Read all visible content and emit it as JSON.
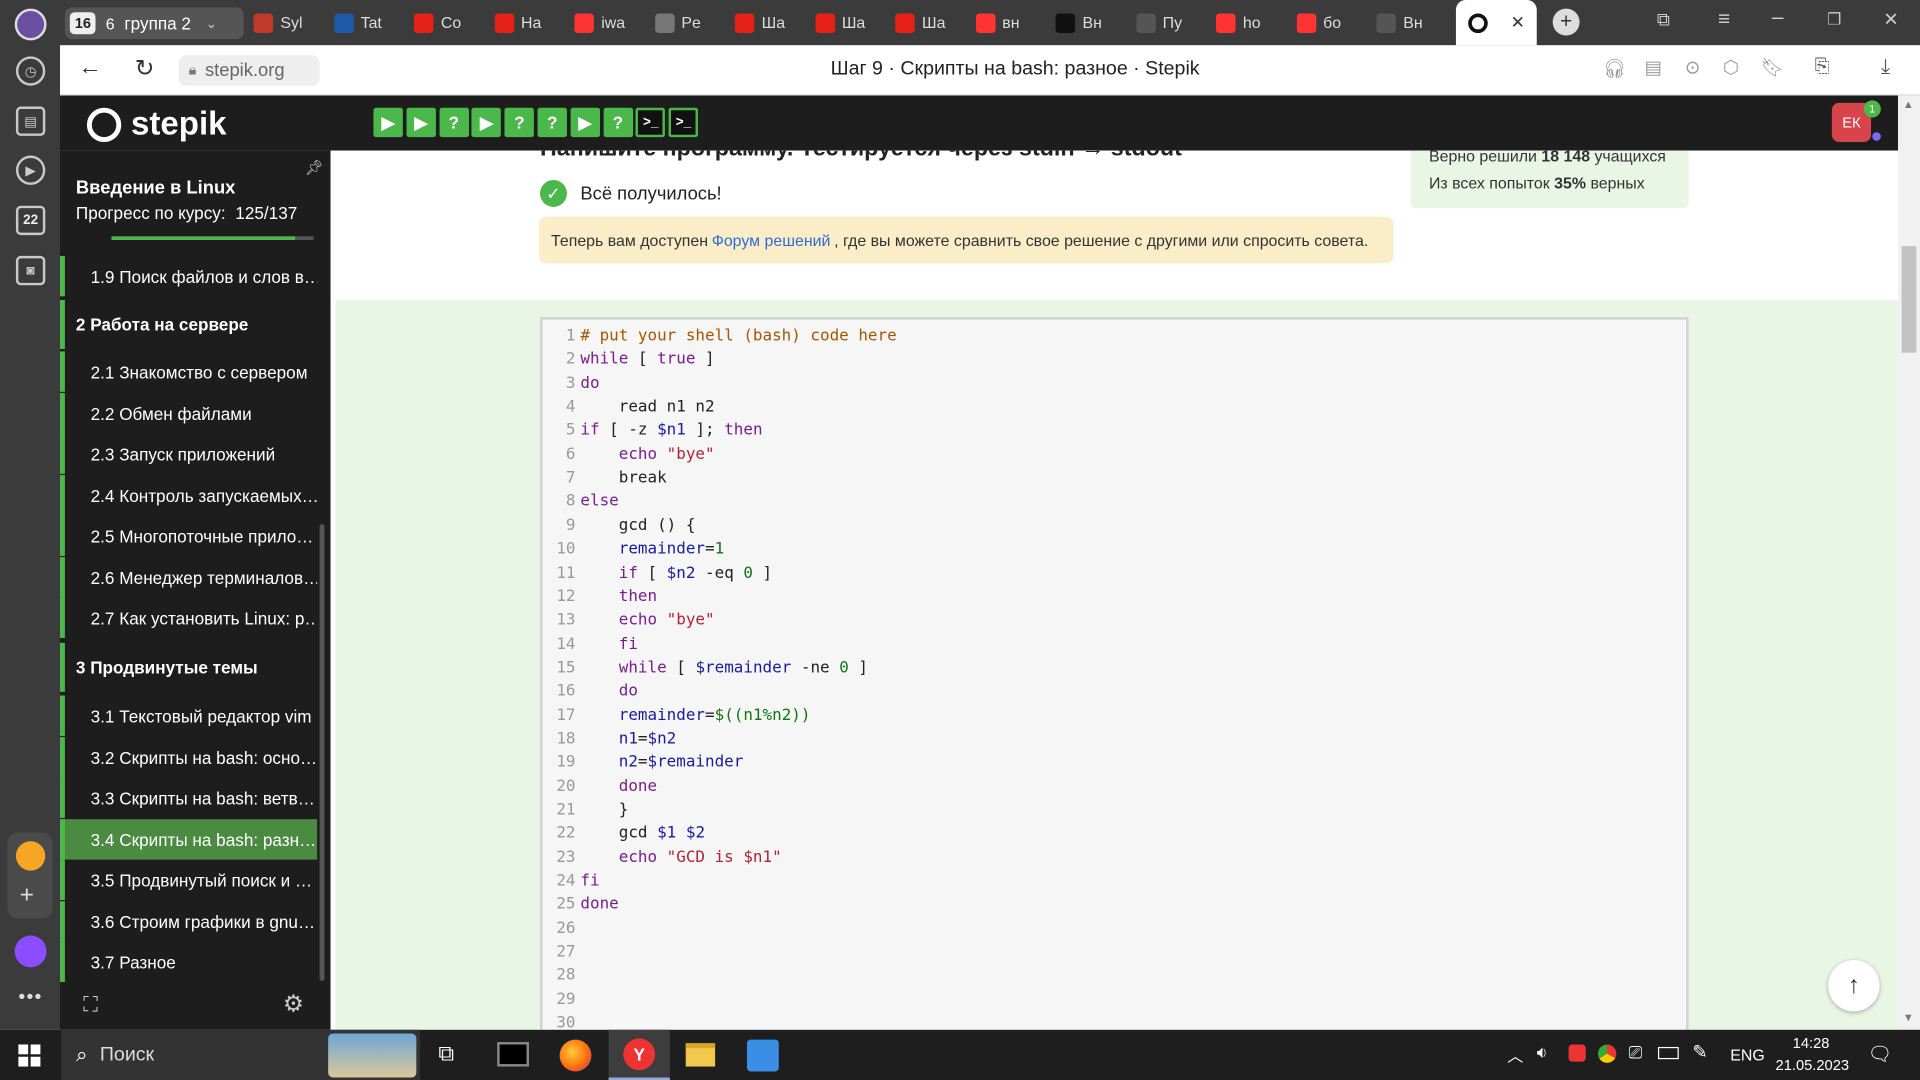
{
  "browser": {
    "tab_count": "16",
    "group_label": "группа 2",
    "tabs": [
      {
        "label": "Syl",
        "icon": "mit-icon",
        "color": "#c0392b"
      },
      {
        "label": "Tat",
        "icon": "blue-circle-icon",
        "color": "#1e5aa8"
      },
      {
        "label": "Co",
        "icon": "youtube-icon",
        "color": "#e62117"
      },
      {
        "label": "Ha",
        "icon": "youtube-icon",
        "color": "#e62117"
      },
      {
        "label": "iwa",
        "icon": "yandex-icon",
        "color": "#f33"
      },
      {
        "label": "Pe",
        "icon": "hat-icon",
        "color": "#777"
      },
      {
        "label": "Ша",
        "icon": "youtube-icon",
        "color": "#e62117"
      },
      {
        "label": "Ша",
        "icon": "youtube-icon",
        "color": "#e62117"
      },
      {
        "label": "Ша",
        "icon": "youtube-icon",
        "color": "#e62117"
      },
      {
        "label": "вн",
        "icon": "yandex-icon",
        "color": "#f33"
      },
      {
        "label": "Вн",
        "icon": "imdb-icon",
        "color": "#111"
      },
      {
        "label": "Пу",
        "icon": "document-icon",
        "color": "#555"
      },
      {
        "label": "ho",
        "icon": "yandex-icon",
        "color": "#f33"
      },
      {
        "label": "бо",
        "icon": "yandex-icon",
        "color": "#f33"
      },
      {
        "label": "Вн",
        "icon": "document-icon",
        "color": "#555"
      }
    ],
    "url": "stepik.org",
    "page_title": "Шаг 9 · Скрипты на bash: разное · Stepik"
  },
  "stepik": {
    "logo": "stepik",
    "avatar": "ЕК",
    "notif_count": "1",
    "step_icons": [
      "play",
      "play",
      "?",
      "play",
      "?",
      "?",
      "play",
      "?",
      "terminal",
      "terminal"
    ]
  },
  "sidebar": {
    "course_title": "Введение в Linux",
    "progress_label": "Прогресс по курсу:",
    "progress_value": "125/137",
    "progress": 0.912,
    "items": [
      {
        "label": "1.9  Поиск файлов и слов в…",
        "type": "lesson"
      },
      {
        "label": "2  Работа на сервере",
        "type": "section"
      },
      {
        "label": "2.1  Знакомство с сервером",
        "type": "lesson"
      },
      {
        "label": "2.2  Обмен файлами",
        "type": "lesson"
      },
      {
        "label": "2.3  Запуск приложений",
        "type": "lesson"
      },
      {
        "label": "2.4  Контроль запускаемых…",
        "type": "lesson"
      },
      {
        "label": "2.5  Многопоточные прило…",
        "type": "lesson"
      },
      {
        "label": "2.6  Менеджер терминалов…",
        "type": "lesson"
      },
      {
        "label": "2.7  Как установить Linux: р…",
        "type": "lesson"
      },
      {
        "label": "3  Продвинутые темы",
        "type": "section"
      },
      {
        "label": "3.1  Текстовый редактор vim",
        "type": "lesson"
      },
      {
        "label": "3.2  Скрипты на bash: осно…",
        "type": "lesson"
      },
      {
        "label": "3.3  Скрипты на bash: ветв…",
        "type": "lesson"
      },
      {
        "label": "3.4  Скрипты на bash: разн…",
        "type": "active"
      },
      {
        "label": "3.5  Продвинутый поиск и …",
        "type": "lesson"
      },
      {
        "label": "3.6  Строим графики в gnu…",
        "type": "lesson"
      },
      {
        "label": "3.7  Разное",
        "type": "lesson"
      }
    ]
  },
  "main": {
    "heading_partial": "Напишите программу. Тестируется через stdin → stdout",
    "success": "Всё получилось!",
    "forum_prefix": "Теперь вам доступен ",
    "forum_link": "Форум решений",
    "forum_suffix": " , где вы можете сравнить свое решение с другими или спросить совета.",
    "stats_line1_prefix": "Верно решили ",
    "stats_line1_value": "18 148",
    "stats_line1_suffix": " учащихся",
    "stats_line2_prefix": "Из всех попыток ",
    "stats_line2_value": "35%",
    "stats_line2_suffix": " верных"
  },
  "code": [
    "# put your shell (bash) code here",
    "while [ true ]",
    "do",
    "    read n1 n2",
    "if [ -z $n1 ]; then",
    "    echo \"bye\"",
    "    break",
    "else",
    "    gcd () {",
    "    remainder=1",
    "    if [ $n2 -eq 0 ]",
    "    then",
    "    echo \"bye\"",
    "    fi",
    "    while [ $remainder -ne 0 ]",
    "    do",
    "    remainder=$((n1%n2))",
    "    n1=$n2",
    "    n2=$remainder",
    "    done",
    "    }",
    "    gcd $1 $2",
    "    echo \"GCD is $n1\"",
    "fi",
    "done",
    "",
    "",
    "",
    "",
    ""
  ],
  "taskbar": {
    "search": "Поиск",
    "lang": "ENG",
    "time": "14:28",
    "date": "21.05.2023"
  }
}
